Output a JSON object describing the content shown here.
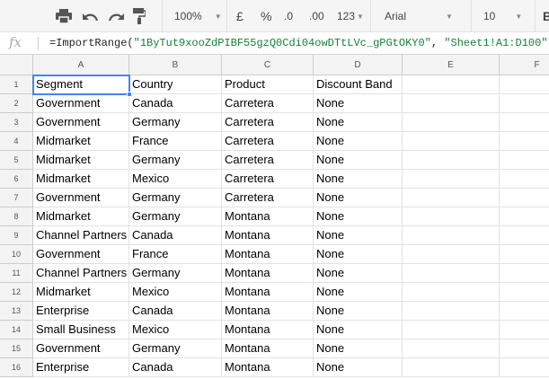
{
  "toolbar": {
    "icons": [
      "print-icon",
      "undo-icon",
      "redo-icon",
      "paint-format-icon"
    ],
    "zoom": "100%",
    "currency": "£",
    "percent": "%",
    "decrease_decimal": ".0",
    "increase_decimal": ".00",
    "more_formats": "123",
    "font": "Arial",
    "font_size": "10"
  },
  "formula_bar": {
    "fx": "fx",
    "prefix": "=ImportRange(",
    "arg1": "\"1ByTut9xooZdPIBF55gzQ0Cdi04owDTtLVc_gPGtOKY0\"",
    "comma": ", ",
    "arg2": "\"Sheet1!A1:D100\"",
    "suffix": ")"
  },
  "columns": [
    "A",
    "B",
    "C",
    "D",
    "E",
    "F"
  ],
  "selected_cell": "A1",
  "rows": [
    [
      "Segment",
      "Country",
      "Product",
      "Discount Band"
    ],
    [
      "Government",
      "Canada",
      "Carretera",
      "None"
    ],
    [
      "Government",
      "Germany",
      "Carretera",
      "None"
    ],
    [
      "Midmarket",
      "France",
      "Carretera",
      "None"
    ],
    [
      "Midmarket",
      "Germany",
      "Carretera",
      "None"
    ],
    [
      "Midmarket",
      "Mexico",
      "Carretera",
      "None"
    ],
    [
      "Government",
      "Germany",
      "Carretera",
      "None"
    ],
    [
      "Midmarket",
      "Germany",
      "Montana",
      "None"
    ],
    [
      "Channel Partners",
      "Canada",
      "Montana",
      "None"
    ],
    [
      "Government",
      "France",
      "Montana",
      "None"
    ],
    [
      "Channel Partners",
      "Germany",
      "Montana",
      "None"
    ],
    [
      "Midmarket",
      "Mexico",
      "Montana",
      "None"
    ],
    [
      "Enterprise",
      "Canada",
      "Montana",
      "None"
    ],
    [
      "Small Business",
      "Mexico",
      "Montana",
      "None"
    ],
    [
      "Government",
      "Germany",
      "Montana",
      "None"
    ],
    [
      "Enterprise",
      "Canada",
      "Montana",
      "None"
    ]
  ]
}
